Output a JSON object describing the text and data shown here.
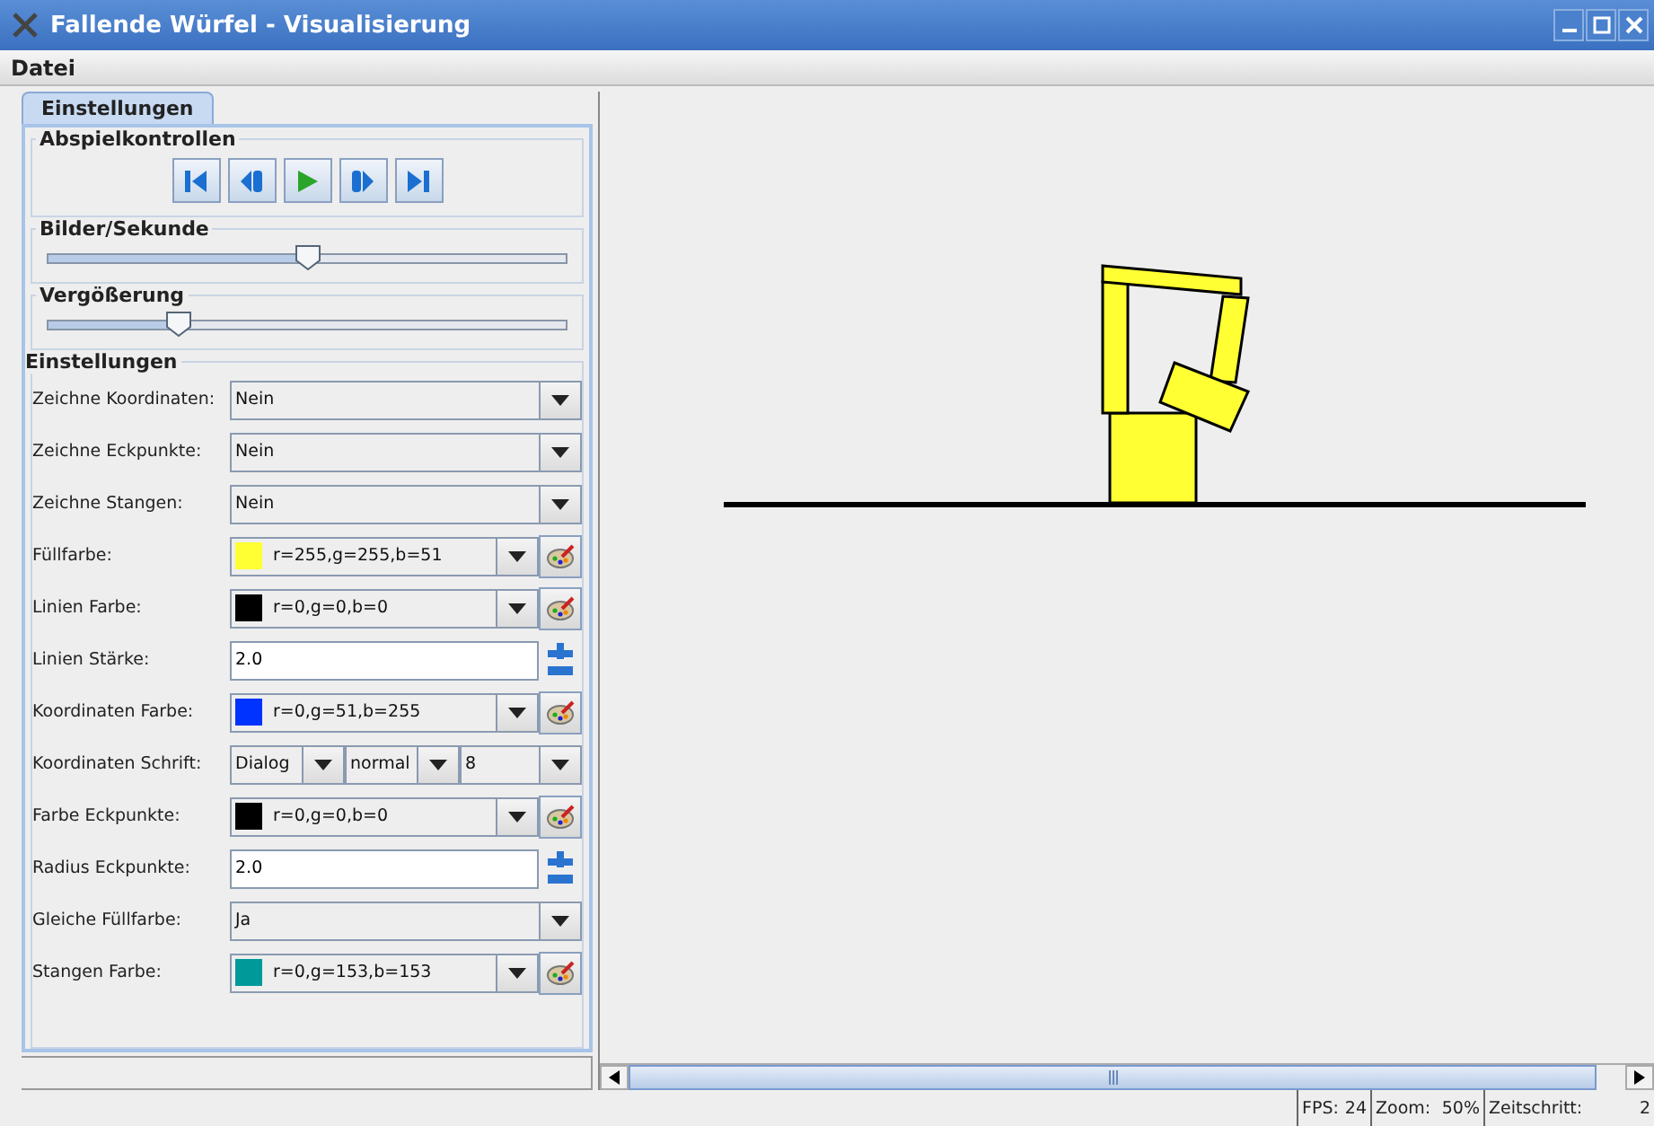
{
  "window": {
    "title": "Fallende Würfel - Visualisierung"
  },
  "menu": [
    "Datei"
  ],
  "tabs": [
    {
      "label": "Einstellungen",
      "selected": true
    }
  ],
  "playback": {
    "title": "Abspielkontrollen",
    "buttons": [
      {
        "kind": "first"
      },
      {
        "kind": "back"
      },
      {
        "kind": "play"
      },
      {
        "kind": "forward"
      },
      {
        "kind": "last"
      }
    ]
  },
  "sliders": [
    {
      "title": "Bilder/Sekunde",
      "level": 0.5
    },
    {
      "title": "Vergößerung",
      "level": 0.25
    }
  ],
  "settings": {
    "title": "Einstellungen",
    "rows": [
      {
        "label": "Zeichne Koordinaten:",
        "kind": "select",
        "value": "Nein"
      },
      {
        "label": "Zeichne Eckpunkte:",
        "kind": "select",
        "value": "Nein"
      },
      {
        "label": "Zeichne Stangen:",
        "kind": "select",
        "value": "Nein"
      },
      {
        "label": "Füllfarbe:",
        "kind": "color",
        "value": "r=255,g=255,b=51",
        "color": "#ffff33"
      },
      {
        "label": "Linien Farbe:",
        "kind": "color",
        "value": "r=0,g=0,b=0",
        "color": "#000000"
      },
      {
        "label": "Linien Stärke:",
        "kind": "spinner",
        "value": "2.0"
      },
      {
        "label": "Koordinaten Farbe:",
        "kind": "color",
        "value": "r=0,g=51,b=255",
        "color": "#0033ff"
      },
      {
        "label": "Koordinaten Schrift:",
        "kind": "font",
        "values": [
          "Dialog",
          "normal",
          "8"
        ]
      },
      {
        "label": "Farbe Eckpunkte:",
        "kind": "color",
        "value": "r=0,g=0,b=0",
        "color": "#000000"
      },
      {
        "label": "Radius Eckpunkte:",
        "kind": "spinner",
        "value": "2.0"
      },
      {
        "label": "Gleiche Füllfarbe:",
        "kind": "select",
        "value": "Ja"
      },
      {
        "label": "Stangen Farbe:",
        "kind": "color",
        "value": "r=0,g=153,b=153",
        "color": "#009999"
      }
    ]
  },
  "status_bar": [
    {
      "label": "FPS:",
      "value": "24"
    },
    {
      "label": "Zoom:",
      "value": "50%"
    },
    {
      "label": "Zeitschritt:",
      "value": "2"
    }
  ]
}
